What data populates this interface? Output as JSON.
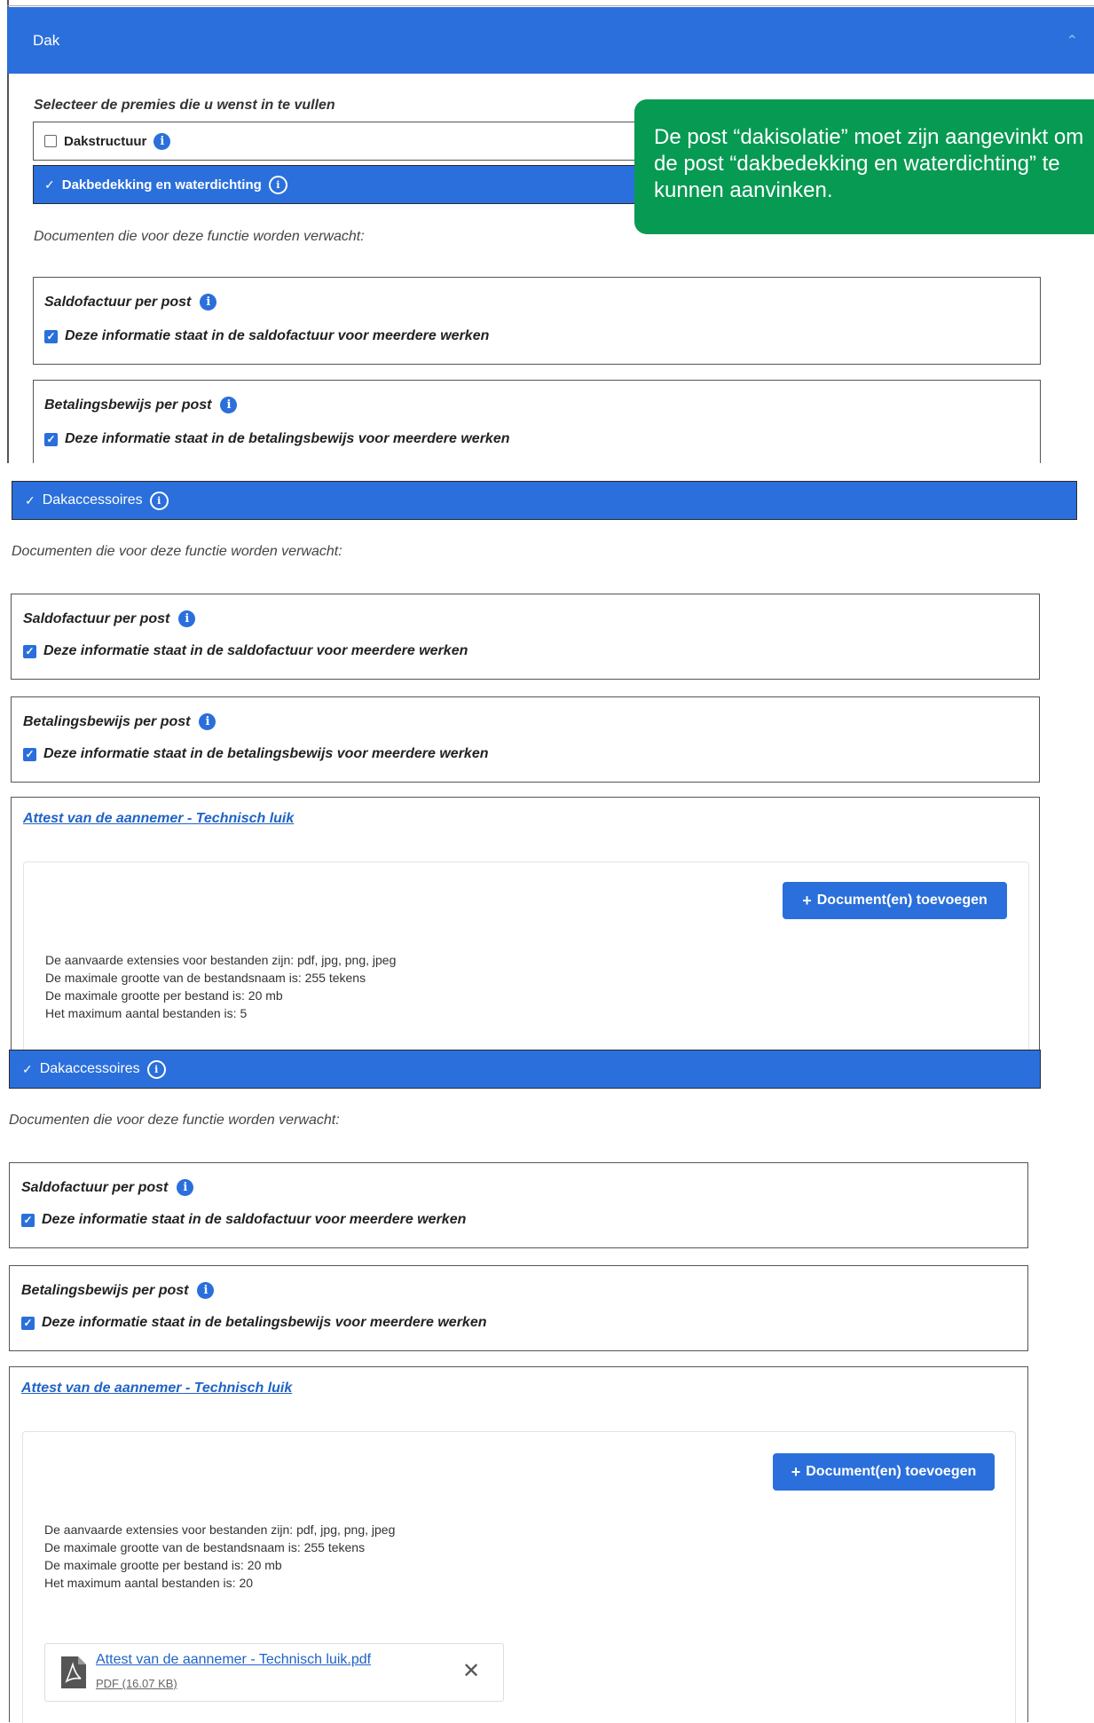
{
  "header": {
    "title": "Dak"
  },
  "select_prompt": "Selecteer de premies die u wenst in te vullen",
  "options": [
    {
      "label": "Dakstructuur",
      "checked": false
    },
    {
      "label": "Dakbedekking en waterdichting",
      "checked": true
    }
  ],
  "callout": {
    "text": "De post “dakisolatie” moet zijn aangevinkt om de post “dakbedekking en waterdichting” te kunnen aanvinken."
  },
  "docs_expected": "Documenten die voor deze functie worden verwacht:",
  "saldo": {
    "title": "Saldofactuur per post",
    "check": "Deze informatie staat in de saldofactuur voor meerdere werken"
  },
  "betaling": {
    "title": "Betalingsbewijs per post",
    "check": "Deze informatie staat in de betalingsbewijs voor meerdere werken"
  },
  "accessoires": {
    "label": "Dakaccessoires"
  },
  "attest": {
    "link": "Attest van de aannemer - Technisch luik"
  },
  "upload": {
    "button": "Document(en) toevoegen",
    "rules_a": [
      "De aanvaarde extensies voor bestanden zijn: pdf, jpg, png, jpeg",
      "De maximale grootte van de bestandsnaam is: 255 tekens",
      "De maximale grootte per bestand is: 20 mb",
      "Het maximum aantal bestanden is: 5"
    ],
    "rules_b": [
      "De aanvaarde extensies voor bestanden zijn: pdf, jpg, png, jpeg",
      "De maximale grootte van de bestandsnaam is: 255 tekens",
      "De maximale grootte per bestand is: 20 mb",
      "Het maximum aantal bestanden is: 20"
    ]
  },
  "file": {
    "name": "Attest van de aannemer - Technisch luik.pdf",
    "meta": "PDF (16.07 KB)"
  },
  "colors": {
    "primary": "#2a6fdb",
    "callout": "#079a52"
  }
}
